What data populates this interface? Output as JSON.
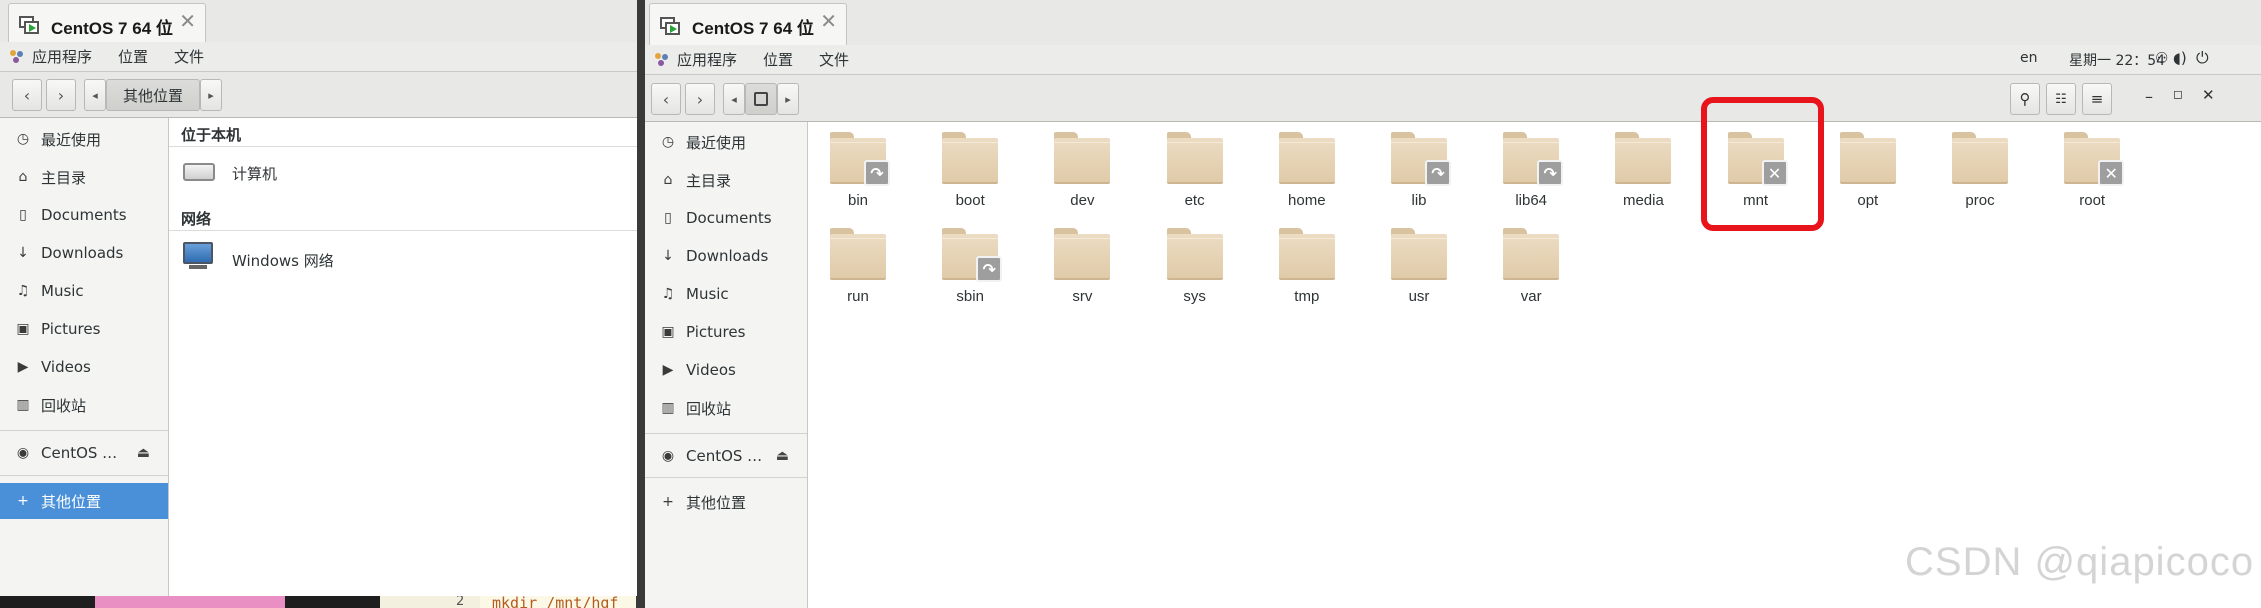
{
  "left_window": {
    "tab": {
      "title": "CentOS 7 64 位",
      "close": "✕"
    },
    "menubar": [
      "应用程序",
      "位置",
      "文件"
    ],
    "path_button": "其他位置",
    "sidebar": [
      {
        "icon": "◷",
        "label": "最近使用"
      },
      {
        "icon": "⌂",
        "label": "主目录"
      },
      {
        "icon": "▯",
        "label": "Documents"
      },
      {
        "icon": "↓",
        "label": "Downloads"
      },
      {
        "icon": "♫",
        "label": "Music"
      },
      {
        "icon": "▣",
        "label": "Pictures"
      },
      {
        "icon": "▶",
        "label": "Videos"
      },
      {
        "icon": "▥",
        "label": "回收站"
      }
    ],
    "device": {
      "icon": "◉",
      "label": "CentOS …",
      "eject": "⏏"
    },
    "other_locations": {
      "icon": "+",
      "label": "其他位置"
    },
    "sections": [
      {
        "header": "位于本机",
        "item": "计算机"
      },
      {
        "header": "网络",
        "item": "Windows 网络"
      }
    ]
  },
  "right_window": {
    "tab": {
      "title": "CentOS 7 64 位",
      "close": "✕"
    },
    "menubar": [
      "应用程序",
      "位置",
      "文件"
    ],
    "status": {
      "lang": "en",
      "clock": "星期一 22：54"
    },
    "sidebar": [
      {
        "icon": "◷",
        "label": "最近使用"
      },
      {
        "icon": "⌂",
        "label": "主目录"
      },
      {
        "icon": "▯",
        "label": "Documents"
      },
      {
        "icon": "↓",
        "label": "Downloads"
      },
      {
        "icon": "♫",
        "label": "Music"
      },
      {
        "icon": "▣",
        "label": "Pictures"
      },
      {
        "icon": "▶",
        "label": "Videos"
      },
      {
        "icon": "▥",
        "label": "回收站"
      }
    ],
    "device": {
      "icon": "◉",
      "label": "CentOS …",
      "eject": "⏏"
    },
    "other_locations": {
      "icon": "+",
      "label": "其他位置"
    },
    "folders": [
      {
        "name": "bin",
        "emblem": "↷"
      },
      {
        "name": "boot",
        "emblem": ""
      },
      {
        "name": "dev",
        "emblem": ""
      },
      {
        "name": "etc",
        "emblem": ""
      },
      {
        "name": "home",
        "emblem": ""
      },
      {
        "name": "lib",
        "emblem": "↷"
      },
      {
        "name": "lib64",
        "emblem": "↷"
      },
      {
        "name": "media",
        "emblem": ""
      },
      {
        "name": "mnt",
        "emblem": "✕"
      },
      {
        "name": "opt",
        "emblem": ""
      },
      {
        "name": "proc",
        "emblem": ""
      },
      {
        "name": "root",
        "emblem": "✕"
      },
      {
        "name": "run",
        "emblem": ""
      },
      {
        "name": "sbin",
        "emblem": "↷"
      },
      {
        "name": "srv",
        "emblem": ""
      },
      {
        "name": "sys",
        "emblem": ""
      },
      {
        "name": "tmp",
        "emblem": ""
      },
      {
        "name": "usr",
        "emblem": ""
      },
      {
        "name": "var",
        "emblem": ""
      }
    ]
  },
  "background": {
    "terminal_line_no": "2",
    "terminal_text": "mkdir /mnt/hgf"
  },
  "watermark": "CSDN @qiapicoco",
  "colors": {
    "highlight_box": "#e8141c",
    "selection": "#4a90d9",
    "folder": "#e6d3b5"
  }
}
